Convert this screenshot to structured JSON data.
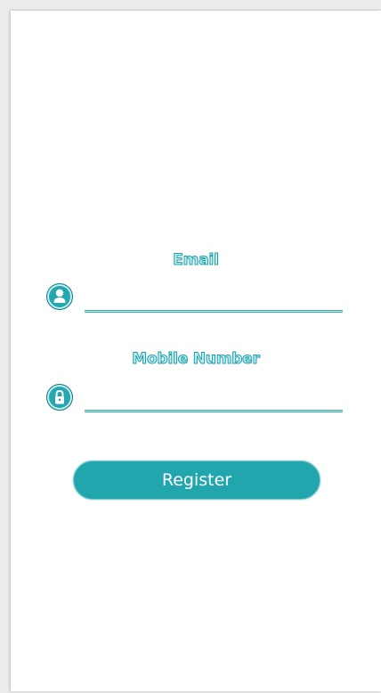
{
  "form": {
    "email_label": "Email",
    "email_value": "",
    "mobile_label": "Mobile Number",
    "mobile_value": "",
    "register_label": "Register"
  },
  "colors": {
    "accent": "#22a6ae",
    "label_fill": "#bfeff1",
    "label_stroke": "#1e9fa8",
    "background": "#ffffff"
  },
  "icons": {
    "email": "user-icon",
    "mobile": "lock-icon"
  }
}
